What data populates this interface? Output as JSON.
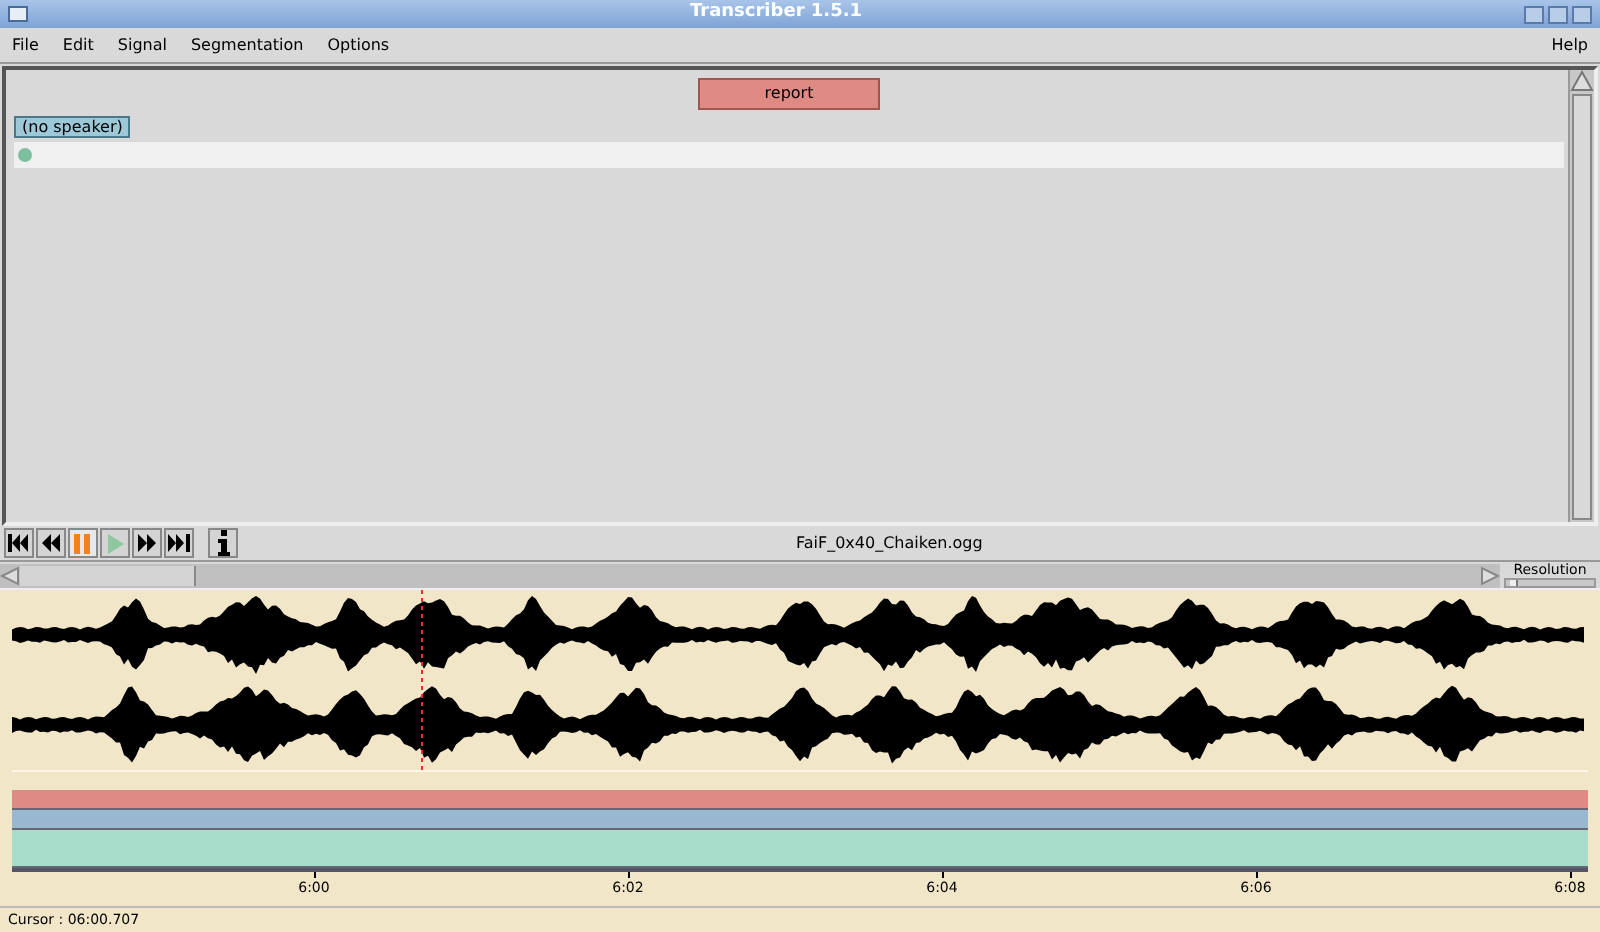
{
  "window": {
    "title": "Transcriber 1.5.1"
  },
  "menu": [
    {
      "label": "File"
    },
    {
      "label": "Edit"
    },
    {
      "label": "Signal"
    },
    {
      "label": "Segmentation"
    },
    {
      "label": "Options"
    }
  ],
  "help_menu": {
    "label": "Help"
  },
  "editor": {
    "section_button": "report",
    "speaker_button": "(no speaker)"
  },
  "transport": [
    {
      "kind": "first",
      "active": false,
      "disabled": false
    },
    {
      "kind": "rewind",
      "active": false,
      "disabled": false
    },
    {
      "kind": "pause",
      "active": true,
      "disabled": false
    },
    {
      "kind": "play",
      "active": false,
      "disabled": true
    },
    {
      "kind": "forward",
      "active": false,
      "disabled": false
    },
    {
      "kind": "last",
      "active": false,
      "disabled": false
    },
    {
      "kind": "info",
      "active": false,
      "disabled": false
    }
  ],
  "filename": "FaiF_0x40_Chaiken.ogg",
  "resolution_label": "Resolution",
  "resolution": {
    "level": 0.1
  },
  "tracks": [
    {
      "color": "#e08a84"
    },
    {
      "color": "#98b8d0"
    },
    {
      "color": "#a8dccb"
    }
  ],
  "axis": {
    "ticks": [
      "6:00",
      "6:02",
      "6:04",
      "6:06",
      "6:08"
    ]
  },
  "status": {
    "cursor": "Cursor : 06:00.707"
  }
}
